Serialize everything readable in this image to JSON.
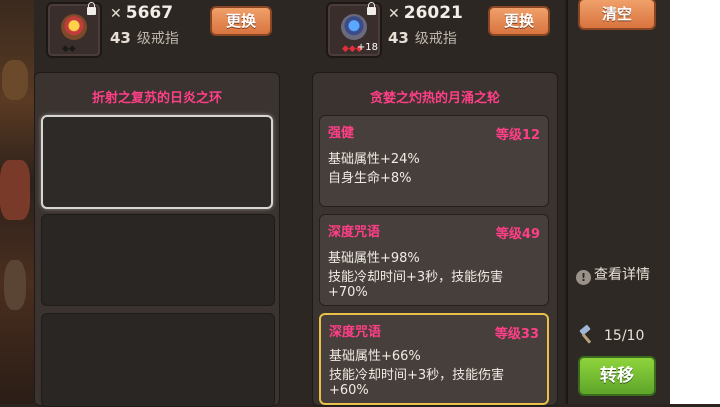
{
  "left_item": {
    "power": "5667",
    "level": "43",
    "type": "级戒指",
    "change_label": "更换"
  },
  "right_item": {
    "power": "26021",
    "level": "43",
    "type": "级戒指",
    "enhance": "+18",
    "change_label": "更换"
  },
  "sidebar": {
    "clear_label": "清空",
    "details_label": "查看详情",
    "hammer_count": "15/10",
    "transfer_label": "转移"
  },
  "left_column": {
    "title": "折射之复苏的日炎之环"
  },
  "right_column": {
    "title": "贪婪之灼热的月涌之轮",
    "affixes": [
      {
        "name": "强健",
        "level": "等级12",
        "lines": [
          "基础属性+24%",
          "自身生命+8%"
        ]
      },
      {
        "name": "深度咒语",
        "level": "等级49",
        "lines": [
          "基础属性+98%",
          "技能冷却时间+3秒，技能伤害",
          "+70%"
        ]
      },
      {
        "name": "深度咒语",
        "level": "等级33",
        "lines": [
          "基础属性+66%",
          "技能冷却时间+3秒，技能伤害",
          "+60%"
        ]
      }
    ]
  },
  "colors": {
    "affix_pink": "#ff3f87",
    "button_orange": "#d8743f",
    "button_green": "#5ea52a",
    "selected_gold": "#e9c14a"
  },
  "icons": {
    "power": "crossed-swords-icon",
    "info": "info-icon",
    "hammer": "hammer-icon",
    "arrow": "double-chevron-right-icon",
    "lock": "lock-icon"
  }
}
